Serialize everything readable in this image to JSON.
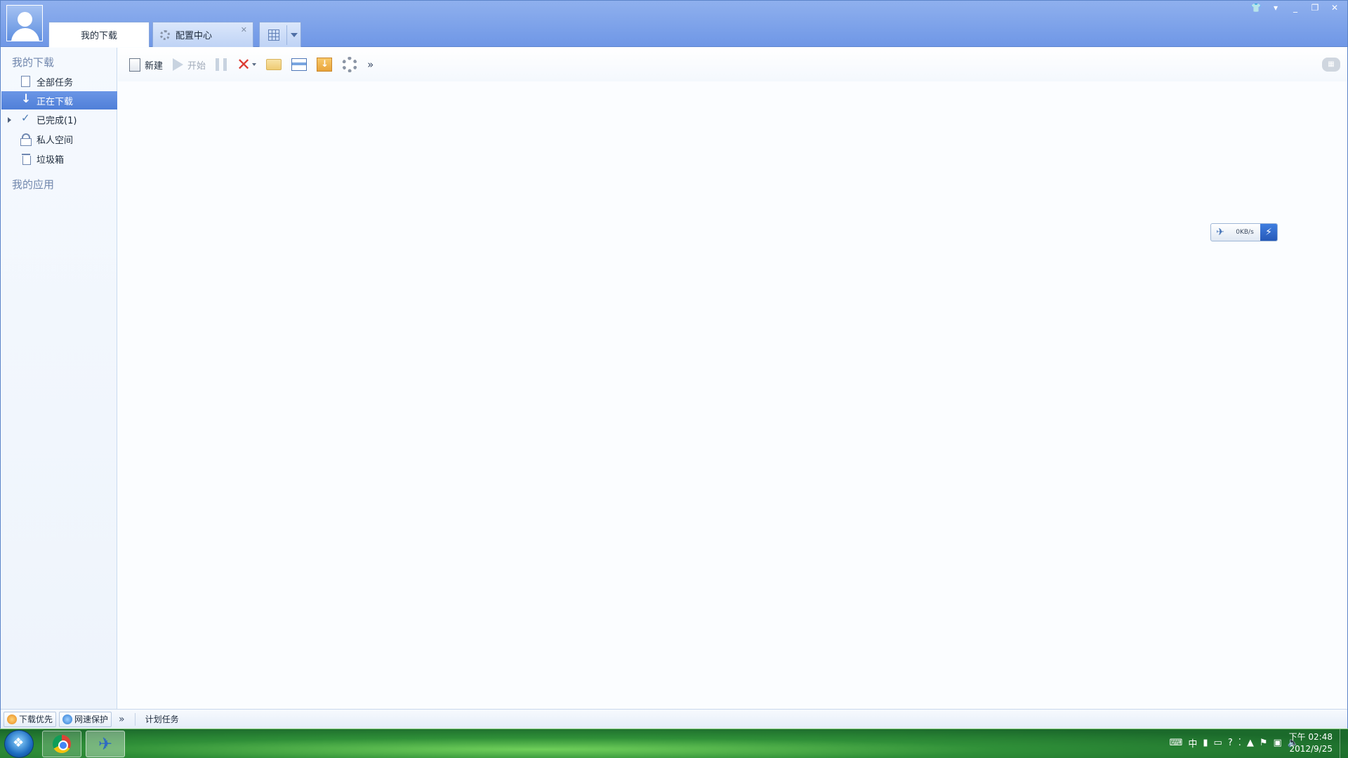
{
  "window": {
    "tabs": [
      {
        "label": "我的下载"
      },
      {
        "label": "配置中心"
      }
    ],
    "controls": [
      "skin",
      "menu",
      "minimize",
      "restore",
      "close"
    ]
  },
  "sidebar": {
    "section_downloads": "我的下载",
    "items": [
      {
        "label": "全部任务",
        "icon": "document-icon"
      },
      {
        "label": "正在下载",
        "icon": "download-arrow-icon",
        "active": true
      },
      {
        "label": "已完成(1)",
        "icon": "checkmark-icon"
      },
      {
        "label": "私人空间",
        "icon": "lock-icon"
      },
      {
        "label": "垃圾箱",
        "icon": "trash-icon"
      }
    ],
    "section_apps": "我的应用"
  },
  "toolbar": {
    "new_label": "新建",
    "start_label": "开始",
    "more": "»"
  },
  "speed": {
    "value": "0KB/s"
  },
  "statusbar": {
    "priority_label": "下载优先",
    "protect_label": "网速保护",
    "more": "»",
    "schedule_label": "计划任务"
  },
  "taskbar": {
    "ime": "中",
    "time": "下午 02:48",
    "date": "2012/9/25"
  },
  "colors": {
    "titlebar": "#7a9fe8",
    "active_nav": "#5a89dc",
    "taskbar": "#2a7d34"
  }
}
